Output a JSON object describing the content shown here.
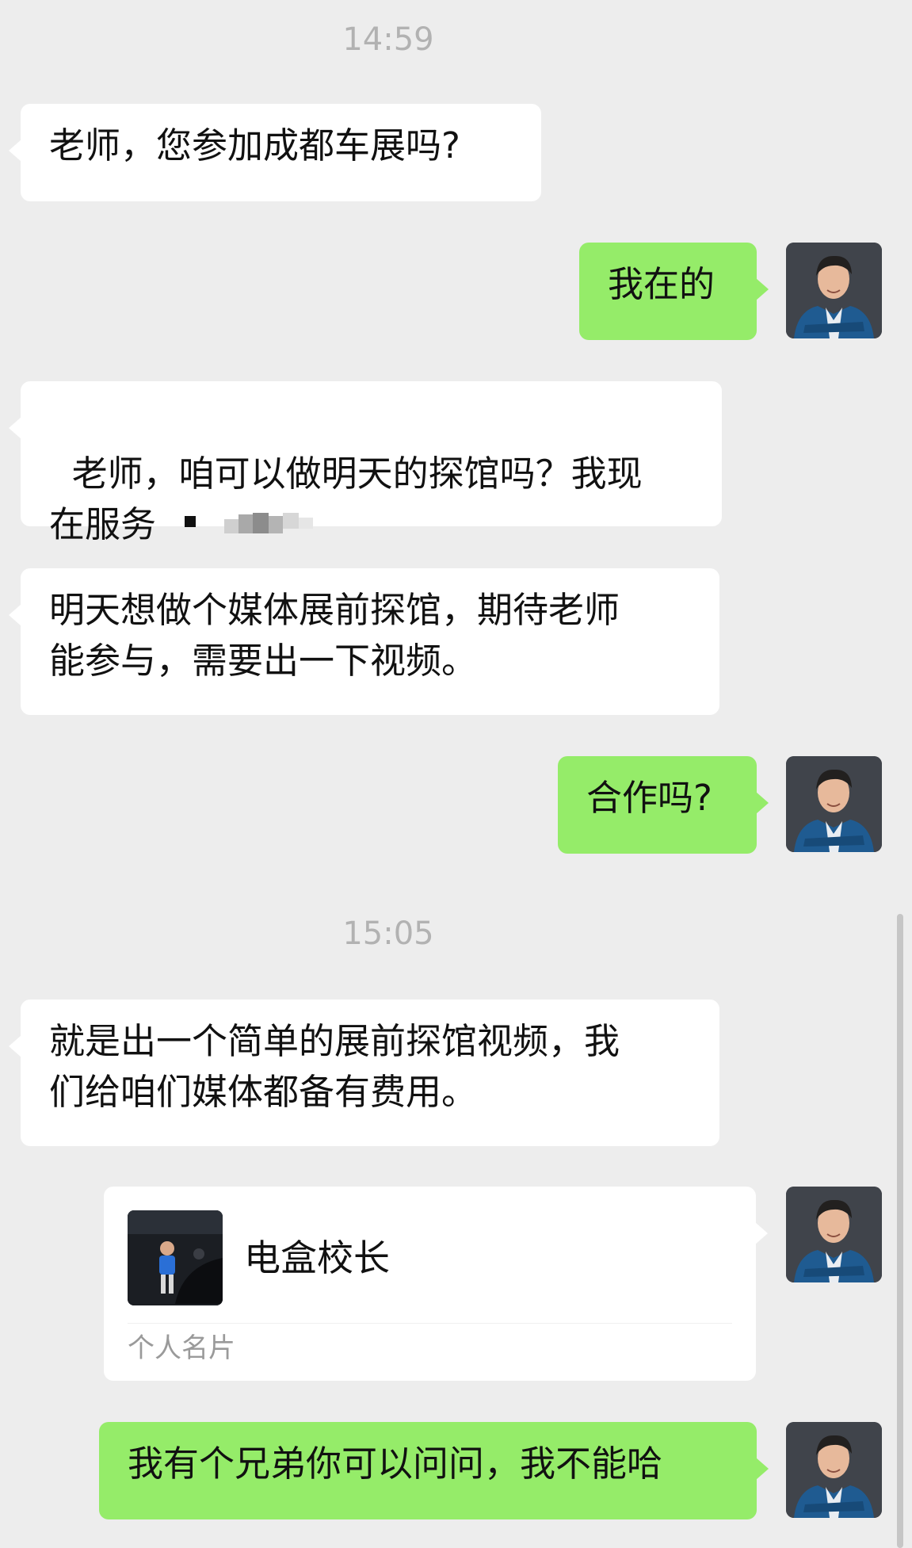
{
  "timestamps": [
    "14:59",
    "15:05"
  ],
  "messages": {
    "m1": "老师，您参加成都车展吗?",
    "m2": "我在的",
    "m3": "老师，咱可以做明天的探馆吗？我现\n在服务",
    "m4": "明天想做个媒体展前探馆，期待老师\n能参与，需要出一下视频。",
    "m5": "合作吗?",
    "m6": "就是出一个简单的展前探馆视频，我\n们给咱们媒体都备有费用。",
    "m7": "我有个兄弟你可以问问，我不能哈"
  },
  "contact_card": {
    "name": "电盒校长",
    "label": "个人名片"
  },
  "colors": {
    "background": "#ededed",
    "incoming_bubble": "#ffffff",
    "outgoing_bubble": "#95ec69",
    "timestamp": "#b2b2b2"
  },
  "icons": [
    "user-avatar",
    "redacted-mosaic",
    "contact-card-photo"
  ]
}
